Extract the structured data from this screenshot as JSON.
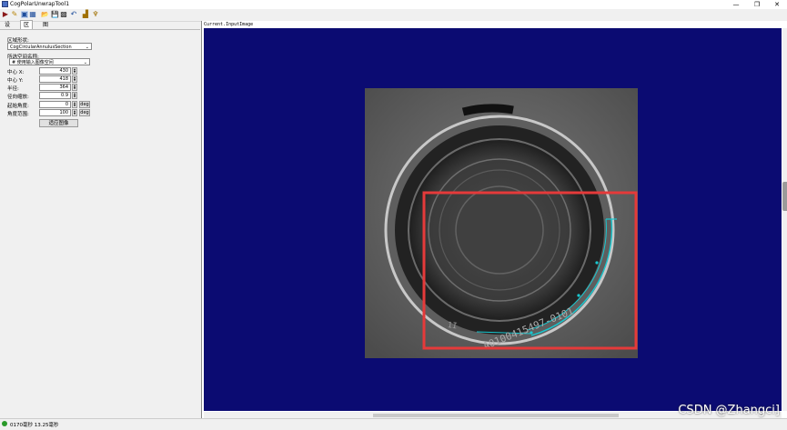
{
  "window": {
    "title": "CogPolarUnwrapTool1",
    "min": "—",
    "max": "❐",
    "close": "✕"
  },
  "toolbar": {
    "items": [
      {
        "icon": "run-icon",
        "glyph": "▶"
      },
      {
        "icon": "wand-icon",
        "glyph": "✎"
      },
      {
        "icon": "region-icon",
        "glyph": "▣"
      },
      {
        "icon": "region-alt-icon",
        "glyph": "▦"
      },
      {
        "icon": "open-icon",
        "glyph": "📂"
      },
      {
        "icon": "save-icon",
        "glyph": "💾"
      },
      {
        "icon": "grid-icon",
        "glyph": "▩"
      },
      {
        "icon": "reset-icon",
        "glyph": "↶"
      },
      {
        "icon": "chart-icon",
        "glyph": "▟"
      },
      {
        "icon": "pin-icon",
        "glyph": "♆"
      }
    ]
  },
  "tabs": [
    "设置",
    "区域",
    "图形"
  ],
  "panel": {
    "region_shape_label": "区域形状:",
    "region_shape_value": "CogCircularAnnulusSection",
    "space_name_label": "所选空间名称:",
    "space_name_value": "# 使用输入图像空间",
    "fields": [
      {
        "label": "中心 X:",
        "value": "430",
        "deg": false
      },
      {
        "label": "中心 Y:",
        "value": "418",
        "deg": false
      },
      {
        "label": "半径:",
        "value": "364",
        "deg": false
      },
      {
        "label": "径向缩放:",
        "value": "0.9",
        "deg": false
      },
      {
        "label": "起始角度:",
        "value": "0",
        "deg": true
      },
      {
        "label": "角度范围:",
        "value": "100",
        "deg": true
      }
    ],
    "deg_label": "deg",
    "fit_button": "适应图像"
  },
  "image_pane": {
    "caption": "Current.InputImage",
    "image_text": {
      "inner_code": "A0100415497-0101",
      "side_text": "1I"
    }
  },
  "status": {
    "text": "0170毫秒 13.25毫秒"
  },
  "watermark": "CSDN @Zhangci]"
}
